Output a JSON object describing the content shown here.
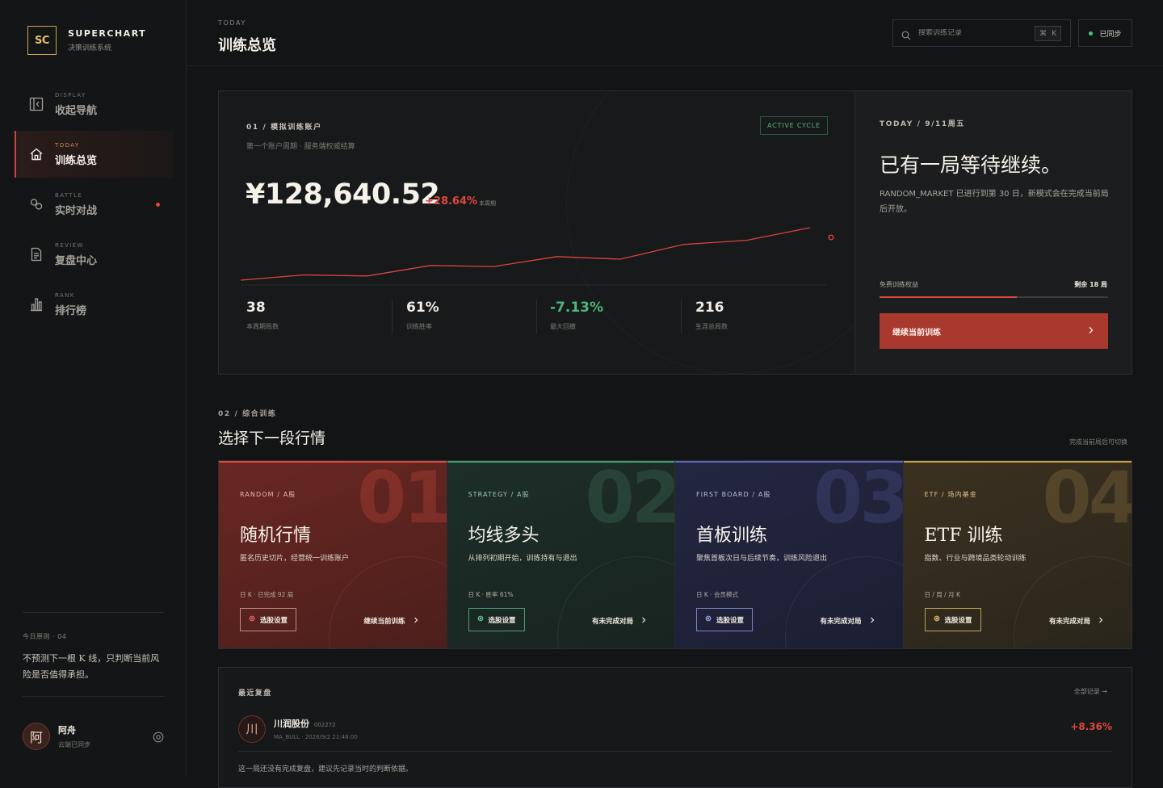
{
  "brand": {
    "logo": "SC",
    "name": "SUPERCHART",
    "subtitle": "决策训练系统"
  },
  "nav": [
    {
      "eyebrow": "DISPLAY",
      "label": "收起导航",
      "icon": "collapse-icon",
      "active": false,
      "badge": false
    },
    {
      "eyebrow": "TODAY",
      "label": "训练总览",
      "icon": "home-icon",
      "active": true,
      "badge": false
    },
    {
      "eyebrow": "BATTLE",
      "label": "实时对战",
      "icon": "battle-icon",
      "active": false,
      "badge": true
    },
    {
      "eyebrow": "REVIEW",
      "label": "复盘中心",
      "icon": "document-icon",
      "active": false,
      "badge": false
    },
    {
      "eyebrow": "RANK",
      "label": "排行榜",
      "icon": "rank-icon",
      "active": false,
      "badge": false
    }
  ],
  "rule": {
    "eyebrow": "今日原则 · 04",
    "text": "不预测下一根 K 线，只判断当前风险是否值得承担。"
  },
  "user": {
    "avatar": "阿",
    "name": "阿舟",
    "status": "云端已同步"
  },
  "header": {
    "eyebrow": "TODAY",
    "title": "训练总览",
    "search_placeholder": "搜索训练记录",
    "search_shortcut_symbol": "⌘",
    "search_shortcut_key": "K",
    "sync_label": "已同步"
  },
  "account": {
    "eyebrow": "01 / 模拟训练账户",
    "subtitle": "第一个账户周期 · 服务端权威结算",
    "cycle_badge": "ACTIVE CYCLE",
    "balance": "¥128,640.52",
    "change": "+28.64%",
    "change_note": "本周期",
    "stats": [
      {
        "value": "38",
        "label": "本周期局数",
        "color": "#f1ede5"
      },
      {
        "value": "61%",
        "label": "训练胜率",
        "color": "#f1ede5"
      },
      {
        "value": "-7.13%",
        "label": "最大回撤",
        "color": "#4cb878"
      },
      {
        "value": "216",
        "label": "生涯总局数",
        "color": "#f1ede5"
      }
    ]
  },
  "chart_data": {
    "type": "line",
    "series": [
      {
        "values": [
          0.0,
          0.1,
          0.08,
          0.28,
          0.26,
          0.45,
          0.4,
          0.68,
          0.76,
          1.0
        ]
      }
    ],
    "ylim": [
      0,
      1
    ],
    "grid": false,
    "colors": {
      "line": "#d9473c",
      "marker": "#e0463c"
    }
  },
  "today": {
    "eyebrow": "TODAY / 9/11周五",
    "title": "已有一局等待继续。",
    "description": "RANDOM_MARKET 已进行到第 30 日，新模式会在完成当前局后开放。",
    "quota_label": "免费训练权益",
    "quota_remaining": "剩余 18 局",
    "quota_progress": 0.6,
    "continue_button": "继续当前训练"
  },
  "training": {
    "eyebrow": "02 / 综合训练",
    "title": "选择下一段行情",
    "note": "完成当前局后可切换",
    "cards": [
      {
        "num": "01",
        "eyebrow": "RANDOM / A股",
        "title": "随机行情",
        "desc": "匿名历史切片，经营统一训练账户",
        "meta": "日 K · 已完成 92 局",
        "button": "选股设置",
        "link": "继续当前训练",
        "bg": "#6a2722",
        "bg2": "#4b1f1c",
        "accent": "#d8493e",
        "eyebrow_color": "#e6b7ad",
        "num_color": "rgba(200,70,58,0.32)",
        "btn_border": "#c7887e",
        "icon_color": "#e0685d"
      },
      {
        "num": "02",
        "eyebrow": "STRATEGY / A股",
        "title": "均线多头",
        "desc": "从排列初期开始，训练持有与退出",
        "meta": "日 K · 胜率 61%",
        "button": "选股设置",
        "link": "有未完成对局",
        "bg": "#1d2e28",
        "bg2": "#182420",
        "accent": "#3f9c74",
        "eyebrow_color": "#9ec7b3",
        "num_color": "rgba(55,95,78,0.45)",
        "btn_border": "#4c9c78",
        "icon_color": "#62c296"
      },
      {
        "num": "03",
        "eyebrow": "FIRST BOARD / A股",
        "title": "首板训练",
        "desc": "聚焦首板次日与后续节奏，训练风险退出",
        "meta": "日 K · 会员模式",
        "button": "选股设置",
        "link": "有未完成对局",
        "bg": "#232640",
        "bg2": "#1c1f33",
        "accent": "#5a63b8",
        "eyebrow_color": "#b6badc",
        "num_color": "rgba(70,78,130,0.4)",
        "btn_border": "#7a82c4",
        "icon_color": "#9aa2e8"
      },
      {
        "num": "04",
        "eyebrow": "ETF / 场内基金",
        "title": "ETF 训练",
        "desc": "指数、行业与跨境品类轮动训练",
        "meta": "日 / 周 / 月 K",
        "button": "选股设置",
        "link": "有未完成对局",
        "bg": "#3b3120",
        "bg2": "#2a251b",
        "accent": "#c49a4a",
        "eyebrow_color": "#e0c58c",
        "num_color": "rgba(120,98,55,0.45)",
        "btn_border": "#c4a15c",
        "icon_color": "#e3bd6c"
      }
    ]
  },
  "recent": {
    "title": "最近复盘",
    "all_link": "全部记录 →",
    "item": {
      "avatar": "川",
      "name": "川润股份",
      "code": "002272",
      "meta": "MA_BULL · 2026/9/2 21:48:00",
      "change": "+8.36%"
    },
    "note": "这一局还没有完成复盘，建议先记录当时的判断依据。"
  }
}
